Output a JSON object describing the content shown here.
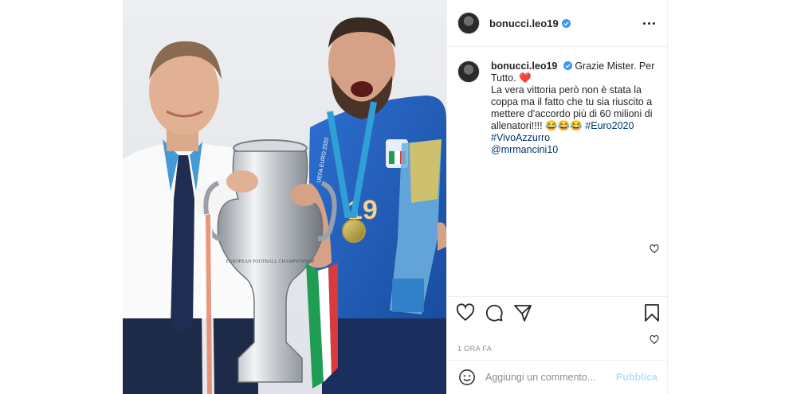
{
  "post": {
    "username": "bonucci.leo19",
    "verified": true
  },
  "photo": {
    "sash_text": "UEFA EURO 2020",
    "shirt_number": "19",
    "trophy_text": "EUROPEAN FOOTBALL CHAMPIONSHIP"
  },
  "caption": {
    "username": "bonucci.leo19",
    "line1": "Grazie Mister. Per Tutto. ❤️",
    "line2": "La vera vittoria però non è stata la coppa ma il fatto che tu sia riuscito a mettere d'accordo più di 60 milioni di allenatori!!!! 😂😂😂",
    "hashtag_euro": "#Euro2020",
    "hashtag_vivo": "#VivoAzzurro",
    "mention": "@mrmancini10"
  },
  "timestamp": "1 ORA FA",
  "add_comment": {
    "placeholder": "Aggiungi un commento...",
    "publish_label": "Pubblica"
  },
  "colors": {
    "verified": "#3897f0",
    "link": "#00376b",
    "publish_disabled": "#b2dffc",
    "border": "#efefef",
    "heart_red": "#ed4956"
  }
}
